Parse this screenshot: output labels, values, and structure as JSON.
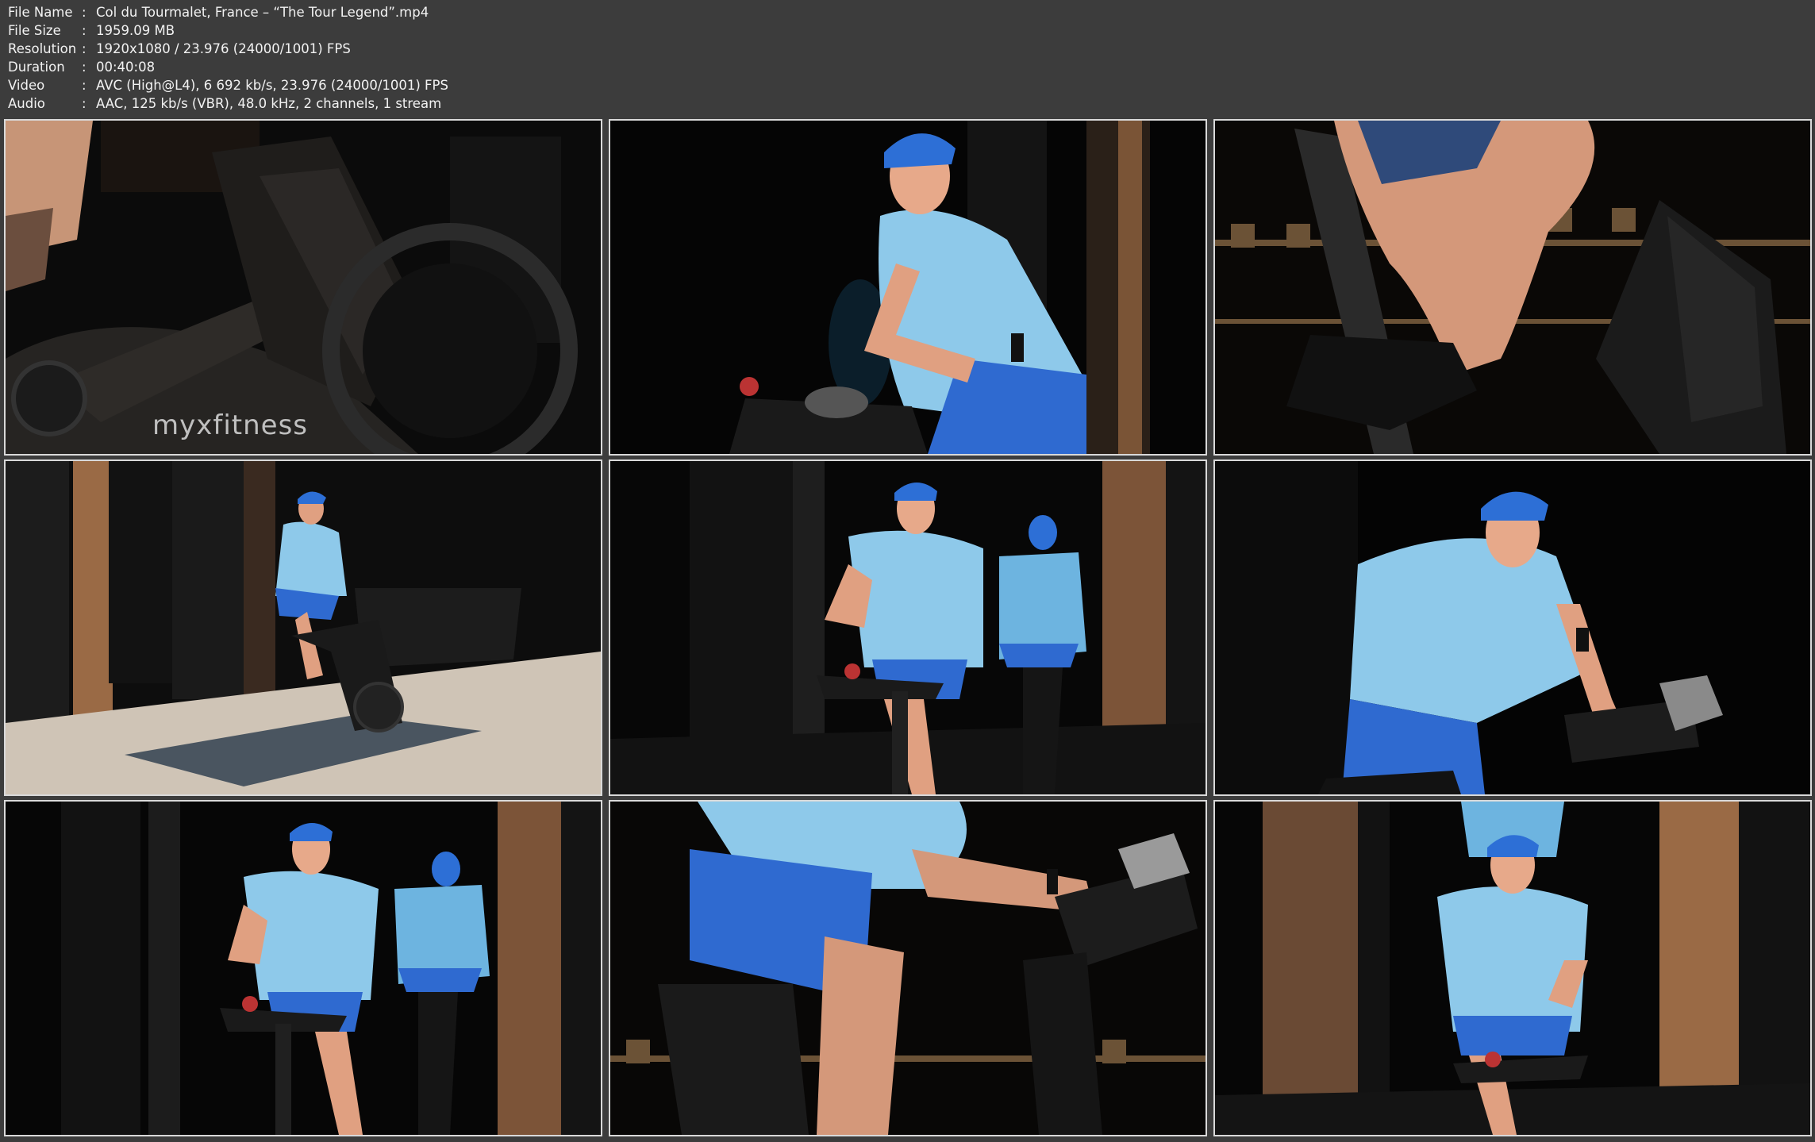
{
  "file_info": {
    "separator": ":",
    "rows": [
      {
        "label": "File Name",
        "value": "Col du Tourmalet, France – “The Tour Legend”.mp4"
      },
      {
        "label": "File Size",
        "value": "1959.09 MB"
      },
      {
        "label": "Resolution",
        "value": "1920x1080 / 23.976 (24000/1001) FPS"
      },
      {
        "label": "Duration",
        "value": "00:40:08"
      },
      {
        "label": "Video",
        "value": "AVC (High@L4), 6 692 kb/s, 23.976 (24000/1001) FPS"
      },
      {
        "label": "Audio",
        "value": "AAC, 125 kb/s (VBR), 48.0 kHz, 2 channels, 1 stream"
      }
    ]
  },
  "thumbnails": {
    "brand_text": "myxfitness",
    "items": [
      {
        "scene": "bike-frame-closeup"
      },
      {
        "scene": "instructor-talking"
      },
      {
        "scene": "leg-pedaling-closeup"
      },
      {
        "scene": "studio-wide-shot"
      },
      {
        "scene": "instructor-pointing-with-rider"
      },
      {
        "scene": "instructor-leaning-forward"
      },
      {
        "scene": "instructor-gesturing-with-rider"
      },
      {
        "scene": "instructor-side-closeup"
      },
      {
        "scene": "instructor-smiling-center"
      }
    ]
  },
  "colors": {
    "background": "#3c3c3c",
    "text": "#f2f2f2",
    "thumb_border": "#d9d9d9",
    "shirt": "#8ec9ea",
    "shorts": "#2f6ad0",
    "cap": "#2d6fd6",
    "skin": "#e7a98a",
    "pillar_light": "#c8865a"
  }
}
